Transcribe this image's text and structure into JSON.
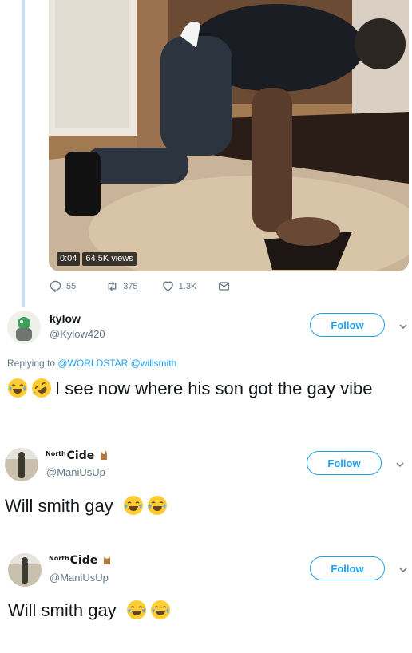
{
  "video": {
    "time": "0:04",
    "views": "64.5K views"
  },
  "actions": {
    "replies": "55",
    "retweets": "375",
    "likes": "1.3K"
  },
  "tweets": [
    {
      "name": "kylow",
      "handle": "@Kylow420",
      "follow_label": "Follow",
      "replying_prefix": "Replying to",
      "replying_links": "@WORLDSTAR @willsmith",
      "emojis": [
        "face-with-tears-of-joy",
        "rolling-on-the-floor-laughing"
      ],
      "text": "I see now where his son got the gay vibe"
    },
    {
      "name_small": "North",
      "name_main": "Cide",
      "handle": "@ManiUsUp",
      "follow_label": "Follow",
      "text": "Will smith gay",
      "emojis": [
        "face-with-tears-of-joy",
        "face-with-tears-of-joy"
      ]
    },
    {
      "name_small": "North",
      "name_main": "Cide",
      "handle": "@ManiUsUp",
      "follow_label": "Follow",
      "text": "Will smith gay",
      "emojis": [
        "face-with-tears-of-joy",
        "face-with-tears-of-joy"
      ]
    }
  ],
  "colors": {
    "accent": "#1da1f2",
    "muted": "#657786",
    "thread_line": "#c4e3f5"
  }
}
